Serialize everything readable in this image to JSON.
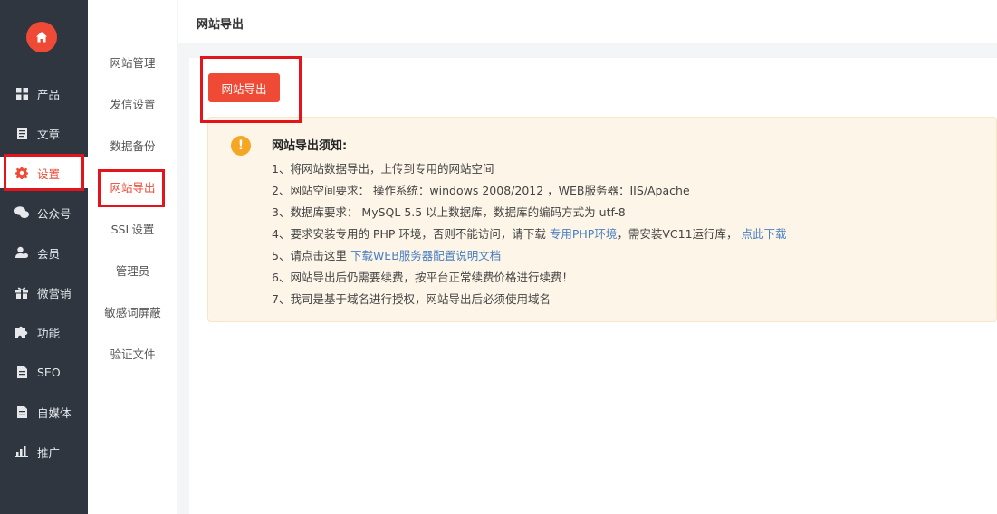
{
  "rail": {
    "items": [
      {
        "label": "产品",
        "icon": "grid-icon"
      },
      {
        "label": "文章",
        "icon": "document-icon"
      },
      {
        "label": "设置",
        "icon": "gear-icon",
        "active": true
      },
      {
        "label": "公众号",
        "icon": "wechat-icon"
      },
      {
        "label": "会员",
        "icon": "user-icon"
      },
      {
        "label": "微营销",
        "icon": "gift-icon"
      },
      {
        "label": "功能",
        "icon": "puzzle-icon"
      },
      {
        "label": "SEO",
        "icon": "seo-doc-icon"
      },
      {
        "label": "自媒体",
        "icon": "media-doc-icon"
      },
      {
        "label": "推广",
        "icon": "chart-icon"
      }
    ]
  },
  "subnav": {
    "items": [
      {
        "label": "网站管理"
      },
      {
        "label": "发信设置"
      },
      {
        "label": "数据备份"
      },
      {
        "label": "网站导出",
        "active": true
      },
      {
        "label": "SSL设置"
      },
      {
        "label": "管理员"
      },
      {
        "label": "敏感词屏蔽"
      },
      {
        "label": "验证文件"
      }
    ]
  },
  "header": {
    "title": "网站导出"
  },
  "main": {
    "export_button": "网站导出",
    "notice": {
      "title": "网站导出须知:",
      "lines": {
        "l1": "1、将网站数据导出，上传到专用的网站空间",
        "l2": "2、网站空间要求： 操作系统：windows 2008/2012 ，WEB服务器：IIS/Apache",
        "l3": "3、数据库要求： MySQL 5.5 以上数据库，数据库的编码方式为 utf-8",
        "l4_a": "4、要求安装专用的 PHP 环境，否则不能访问，请下载 ",
        "l4_link1": "专用PHP环境",
        "l4_b": "，需安装VC11运行库，",
        "l4_link2": "点此下载",
        "l5_a": "5、请点击这里 ",
        "l5_link": "下载WEB服务器配置说明文档",
        "l6": "6、网站导出后仍需要续费，按平台正常续费价格进行续费！",
        "l7": "7、我司是基于域名进行授权，网站导出后必须使用域名"
      }
    }
  },
  "colors": {
    "accent": "#ee4a35",
    "rail_bg": "#2f3640",
    "highlight": "#e3141b",
    "link": "#4a7fc1"
  }
}
